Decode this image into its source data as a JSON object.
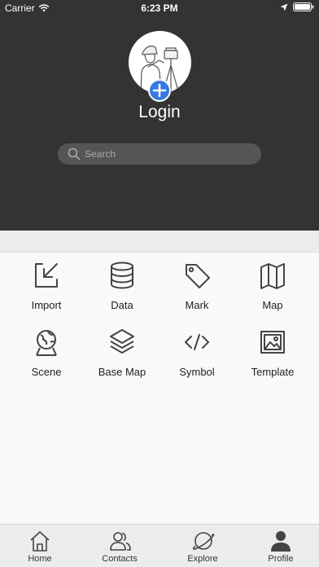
{
  "status_bar": {
    "carrier": "Carrier",
    "time": "6:23 PM"
  },
  "profile": {
    "login_label": "Login"
  },
  "search": {
    "placeholder": "Search"
  },
  "grid": {
    "items": [
      {
        "label": "Import",
        "icon": "import-icon"
      },
      {
        "label": "Data",
        "icon": "database-icon"
      },
      {
        "label": "Mark",
        "icon": "tag-icon"
      },
      {
        "label": "Map",
        "icon": "map-icon"
      },
      {
        "label": "Scene",
        "icon": "globe-icon"
      },
      {
        "label": "Base Map",
        "icon": "layers-icon"
      },
      {
        "label": "Symbol",
        "icon": "code-icon"
      },
      {
        "label": "Template",
        "icon": "template-image-icon"
      }
    ]
  },
  "tabbar": {
    "tabs": [
      {
        "label": "Home",
        "icon": "home-icon"
      },
      {
        "label": "Contacts",
        "icon": "contacts-icon"
      },
      {
        "label": "Explore",
        "icon": "planet-icon"
      },
      {
        "label": "Profile",
        "icon": "person-icon",
        "active": true
      }
    ]
  },
  "colors": {
    "header_bg": "#333333",
    "accent": "#3478e5",
    "tabbar_bg": "#ececec"
  }
}
